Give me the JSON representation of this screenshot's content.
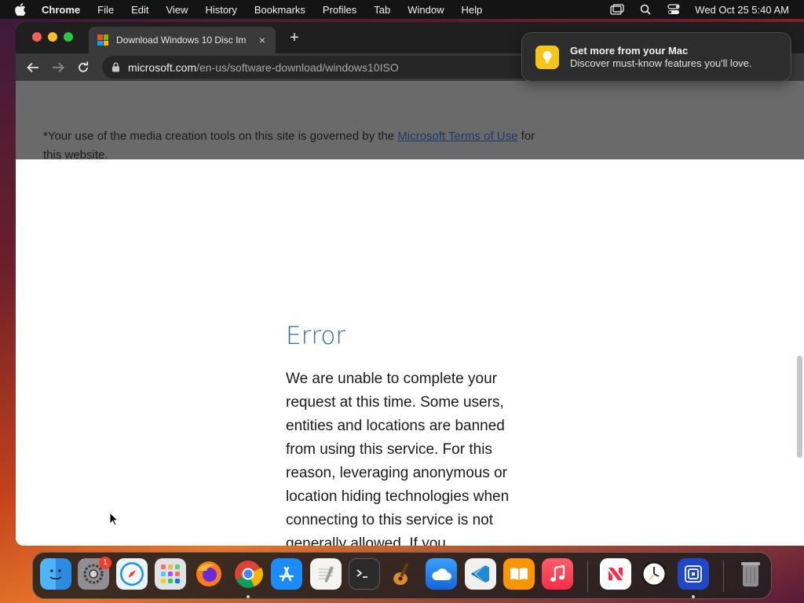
{
  "menubar": {
    "app_name": "Chrome",
    "items": [
      "File",
      "Edit",
      "View",
      "History",
      "Bookmarks",
      "Profiles",
      "Tab",
      "Window",
      "Help"
    ],
    "clock": "Wed Oct 25  5:40 AM"
  },
  "tab": {
    "title": "Download Windows 10 Disc Im",
    "close_glyph": "×",
    "new_tab_glyph": "+"
  },
  "address": {
    "host": "microsoft.com",
    "path": "/en-us/software-download/windows10ISO"
  },
  "page": {
    "terms_prefix": "*Your use of the media creation tools on this site is governed by the ",
    "terms_link": "Microsoft Terms of Use",
    "terms_suffix": " for this website.",
    "error_title": "Error",
    "error_body": "We are unable to complete your request at this time. Some users, entities and locations are banned from using this service. For this reason, leveraging anonymous or location hiding technologies when connecting to this service is not generally allowed. If you"
  },
  "notification": {
    "title": "Get more from your Mac",
    "body": "Discover must-know features you'll love."
  },
  "dock": {
    "apps": [
      "Finder",
      "System Settings",
      "Safari",
      "Launchpad",
      "Firefox",
      "Chrome",
      "App Store",
      "TextEdit",
      "Terminal",
      "GarageBand",
      "iCloud",
      "Visual Studio Code",
      "Books",
      "Music",
      "News",
      "Clock",
      "Screen Sharing",
      "Trash"
    ],
    "system_settings_badge": "1"
  },
  "colors": {
    "error_title": "#2a6ea8",
    "link": "#1e3a6a",
    "close": "#ff5f57",
    "minimize": "#febc2e",
    "maximize": "#28c840"
  }
}
